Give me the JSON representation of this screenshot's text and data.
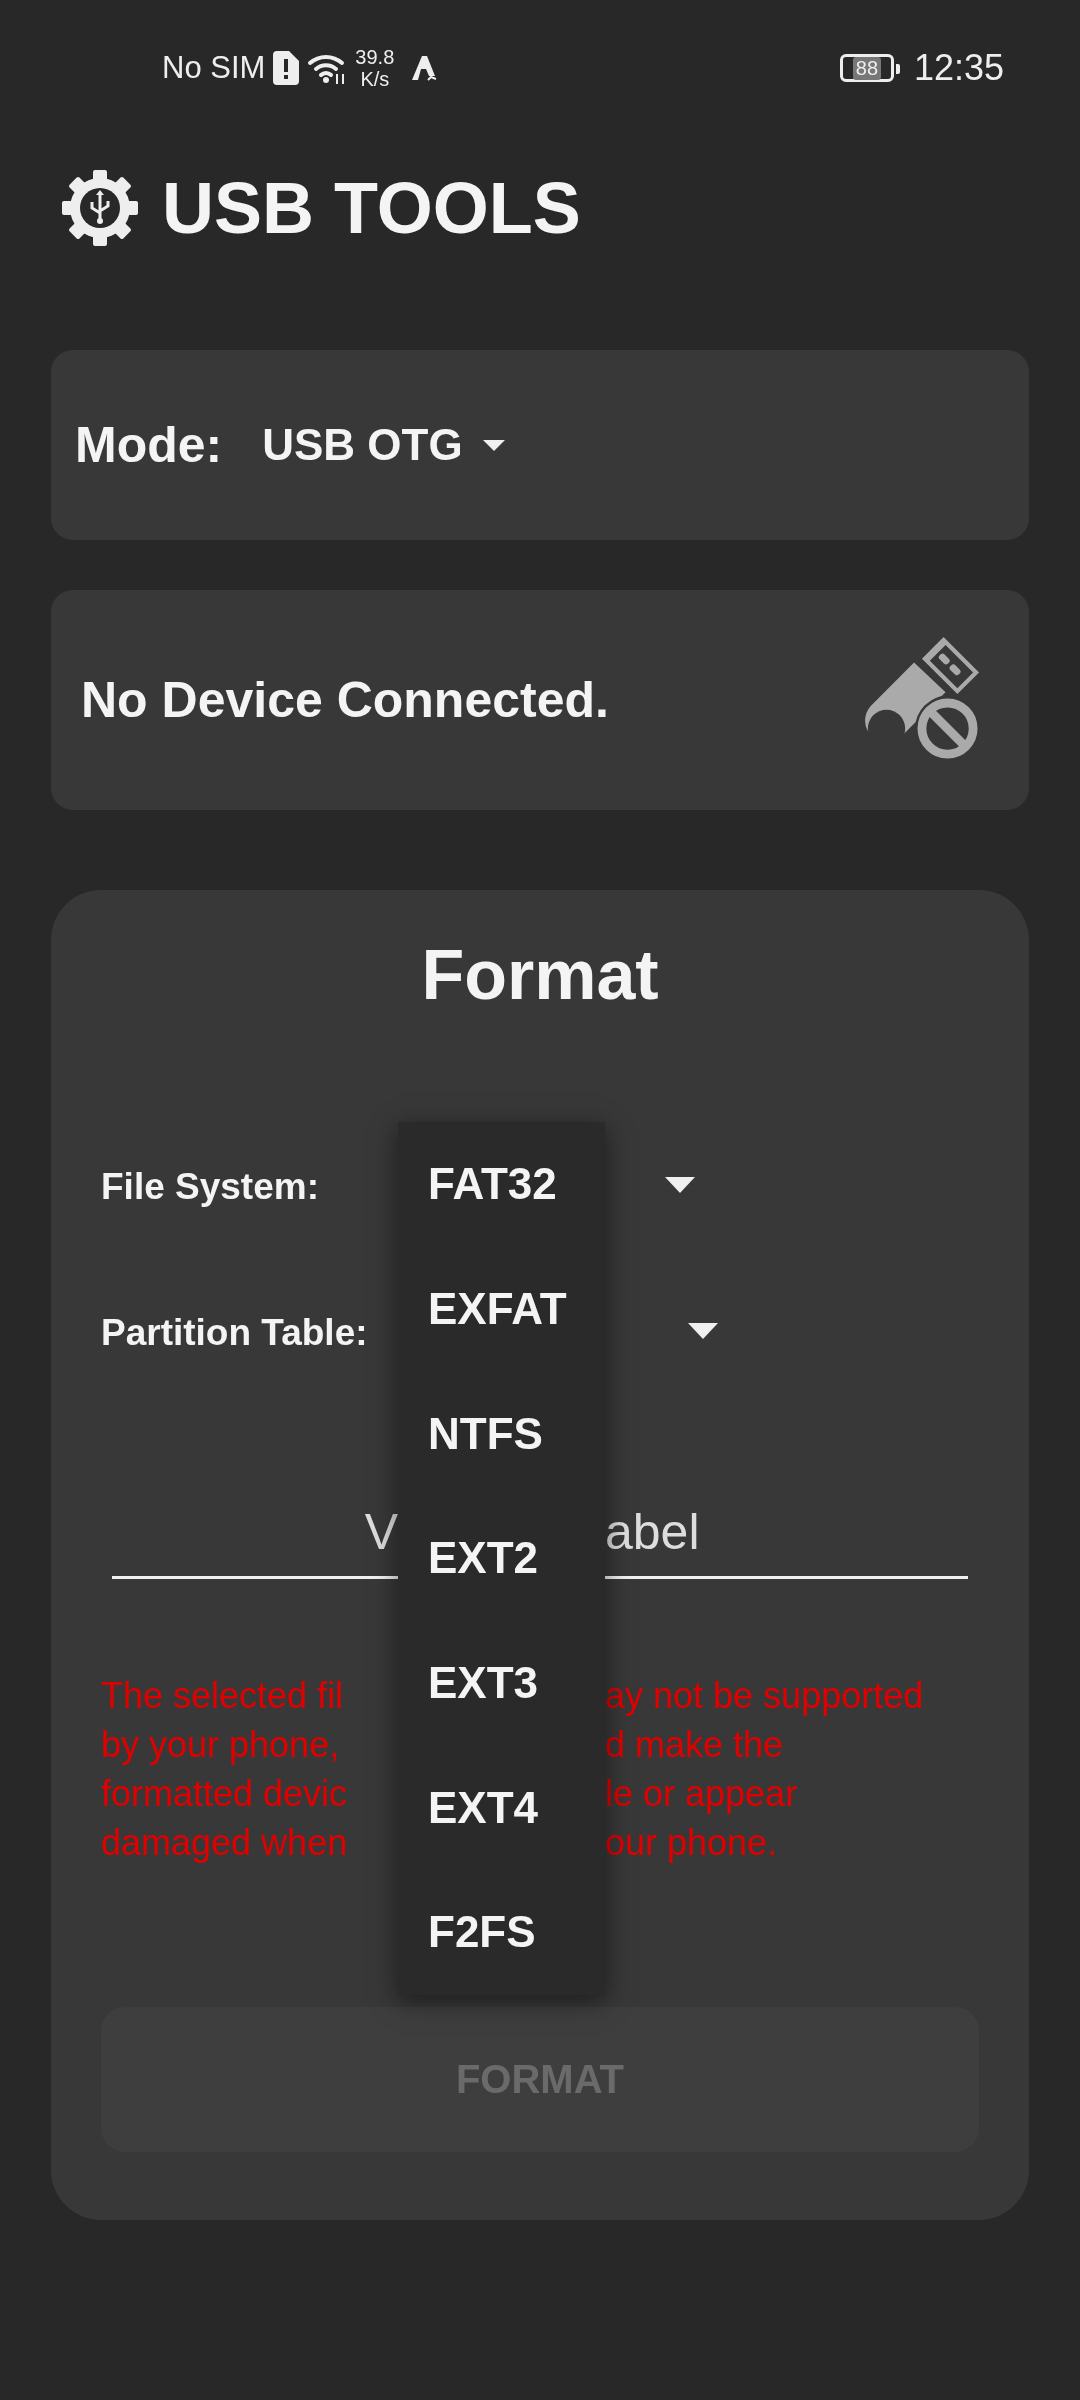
{
  "status_bar": {
    "carrier": "No SIM",
    "speed_value": "39.8",
    "speed_unit": "K/s",
    "battery": "88",
    "time": "12:35"
  },
  "app_title": "USB TOOLS",
  "mode": {
    "label": "Mode:",
    "value": "USB OTG"
  },
  "device": {
    "status": "No Device Connected."
  },
  "format": {
    "title": "Format",
    "file_system_label": "File System:",
    "partition_table_label": "Partition Table:",
    "volume_label_placeholder": {
      "left": "V",
      "right": "abel"
    },
    "warning_lines": [
      {
        "left": "The selected fil",
        "right": "ay not be supported"
      },
      {
        "left": "by your phone,",
        "right": "d make the"
      },
      {
        "left": "formatted devic",
        "right": "le or appear"
      },
      {
        "left": "damaged when",
        "right": "our phone."
      }
    ],
    "button": {
      "label": "FORMAT",
      "disabled": true
    }
  },
  "menu": {
    "items": [
      {
        "label": "FAT32"
      },
      {
        "label": "EXFAT"
      },
      {
        "label": "NTFS"
      },
      {
        "label": "EXT2"
      },
      {
        "label": "EXT3"
      },
      {
        "label": "EXT4"
      },
      {
        "label": "F2FS"
      }
    ]
  }
}
